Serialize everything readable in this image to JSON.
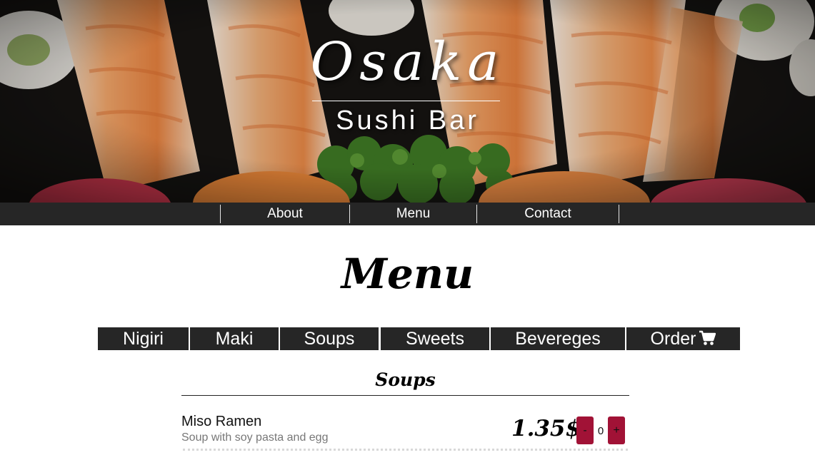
{
  "hero": {
    "title": "Osaka",
    "subtitle": "Sushi Bar"
  },
  "top_nav": {
    "items": [
      {
        "label": "About"
      },
      {
        "label": "Menu"
      },
      {
        "label": "Contact"
      }
    ]
  },
  "menu": {
    "heading": "Menu",
    "tabs": [
      {
        "label": "Nigiri"
      },
      {
        "label": "Maki"
      },
      {
        "label": "Soups"
      },
      {
        "label": "Sweets"
      },
      {
        "label": "Bevereges"
      },
      {
        "label": "Order",
        "icon": "shopping-cart-icon"
      }
    ],
    "section": {
      "title": "Soups",
      "items": [
        {
          "name": "Miso Ramen",
          "description": "Soup with soy pasta and egg",
          "price": "1.35$",
          "decrement_label": "-",
          "quantity": "0",
          "increment_label": "+"
        }
      ]
    }
  },
  "colors": {
    "nav_background": "#262626",
    "accent": "#a11236",
    "hero_background": "#141210"
  }
}
